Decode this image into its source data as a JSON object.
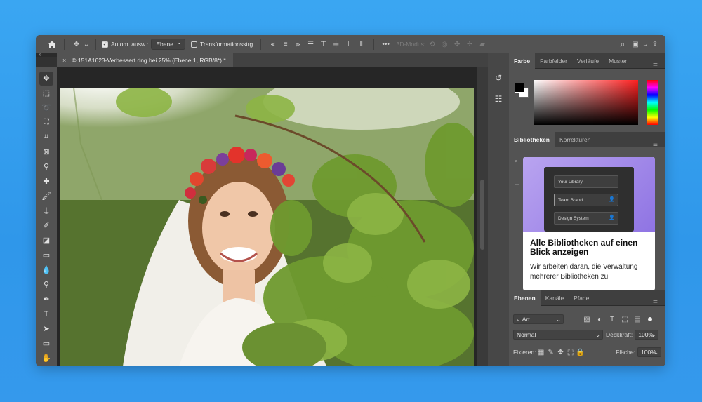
{
  "options_bar": {
    "home_icon": "home-icon",
    "auto_select_label": "Autom. ausw.:",
    "auto_select_value": "Ebene",
    "transform_label": "Transformationsstrg.",
    "mode_3d_label": "3D-Modus:",
    "more_label": "•••"
  },
  "document": {
    "tab_title": "© 151A1623-Verbessert.dng bei 25% (Ebene 1, RGB/8*) *",
    "close_label": "×"
  },
  "colors": {
    "accent": "#2f97ea",
    "panel_bg": "#535353",
    "foreground_swatch": "#000000",
    "background_swatch": "#ffffff"
  },
  "color_panel": {
    "tabs": [
      "Farbe",
      "Farbfelder",
      "Verläufe",
      "Muster"
    ]
  },
  "library_panel": {
    "tabs": [
      "Bibliotheken",
      "Korrekturen"
    ],
    "preview_items": [
      "Your Library",
      "Team Brand",
      "Design System"
    ],
    "title": "Alle Bibliotheken auf einen Blick anzeigen",
    "body": "Wir arbeiten daran, die Verwaltung mehrerer Bibliotheken zu"
  },
  "layers_panel": {
    "tabs": [
      "Ebenen",
      "Kanäle",
      "Pfade"
    ],
    "filter_value": "Art",
    "blend_mode": "Normal",
    "opacity_label": "Deckkraft:",
    "opacity_value": "100%",
    "lock_label": "Fixieren:",
    "fill_label": "Fläche:",
    "fill_value": "100%"
  }
}
